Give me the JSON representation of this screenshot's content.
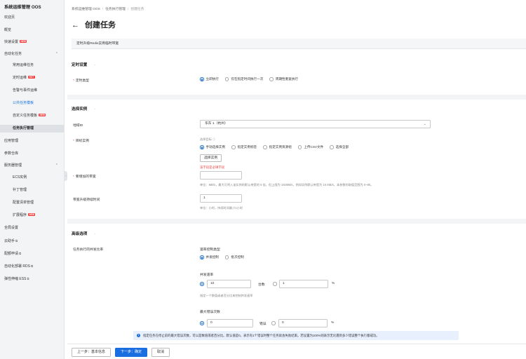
{
  "sidebar": {
    "title": "系统运维管理 OOS",
    "items": [
      {
        "label": "欢迎页"
      },
      {
        "label": "概览"
      },
      {
        "label": "快速设置",
        "badge": "NEW"
      },
      {
        "label": "自动化任务"
      },
      {
        "label": "常用运维任务"
      },
      {
        "label": "定时运维",
        "badge": "HOT"
      },
      {
        "label": "告警与事件运维"
      },
      {
        "label": "公共任务模板"
      },
      {
        "label": "自定义任务模板",
        "badge": "NEW"
      },
      {
        "label": "任务执行管理"
      },
      {
        "label": "应用管理"
      },
      {
        "label": "参数仓库"
      },
      {
        "label": "服务器管理"
      },
      {
        "label": "ECS实例"
      },
      {
        "label": "补丁管理"
      },
      {
        "label": "配置清单管理"
      },
      {
        "label": "扩展程序",
        "badge": "NEW"
      },
      {
        "label": "全局设置"
      },
      {
        "label": "云助手"
      },
      {
        "label": "配额申请"
      },
      {
        "label": "自动化部署 RDS"
      },
      {
        "label": "弹性伸缩 ESS"
      }
    ]
  },
  "breadcrumb": [
    "系统运维管理 OOS",
    "任务执行管理",
    "创建任务"
  ],
  "page": {
    "title": "创建任务",
    "template_name": "定时升级Redis实例临时带宽"
  },
  "sections": {
    "schedule": "定时设置",
    "instances": "选择实例",
    "advanced": "高级选项"
  },
  "schedule": {
    "label": "定时类型",
    "options": [
      "立即执行",
      "仅在指定时间执行一次",
      "周期性重复执行"
    ]
  },
  "instances": {
    "region_label": "地域ID",
    "region_value": "华东 1（杭州）",
    "target_label": "目标实例",
    "target_hint": "选择目标",
    "target_options": [
      "手动选择实例",
      "指定实例标签",
      "指定实例资源组",
      "上传CSV文件",
      "选择全部"
    ],
    "select_button": "选择实例",
    "required_error": "该字段是必填字段",
    "bandwidth_label": "要增加的带宽",
    "bandwidth_hint": "单位：MB/s，最大可将入该实例的默认带宽的 6 倍，但上限为 192MB/s，例如实例默认带宽为 16 MB/s，本参数的取值范围为 0~80。",
    "duration_label": "带宽升级持续时间",
    "duration_value": "1",
    "duration_hint": "单位：小时，持续时间最少1小时"
  },
  "advanced": {
    "concurrency_label": "任务执行的并发比率",
    "rate_type_label": "速率控制类型",
    "rate_type_options": [
      "并发控制",
      "批次控制"
    ],
    "concurrency_rate_label": "并发速率",
    "concurrency_value": "10",
    "concurrency_unit": "台数",
    "concurrency_percent_value": "1",
    "percent_sign": "%",
    "concurrency_hint": "指定一个数值或者百分比来控制并发速率",
    "max_errors_label": "最大错误次数",
    "max_errors_value": "0",
    "max_errors_unit": "错误",
    "max_errors_percent_value": "0",
    "info": "指定任务在停止前的最大错误次数，可以是数值或者百分比。默认值是0，表示有1个错误时整个任务就会失败结束。若设置为100%则表示无论遇到多少错误整个执行都成功。"
  },
  "footer": {
    "prev": "上一步：基本信息",
    "next": "下一步：确定",
    "cancel": "取消"
  },
  "colors": {
    "primary": "#1a6ee0",
    "error": "#e54848",
    "badge": "#f23c3c"
  }
}
